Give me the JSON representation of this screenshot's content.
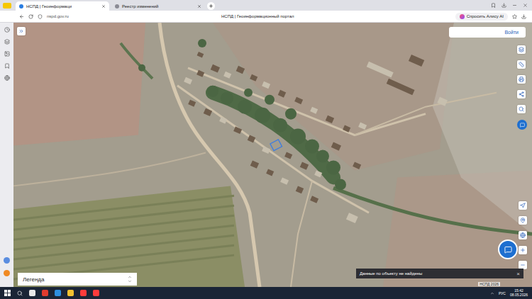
{
  "browser": {
    "tabs": [
      {
        "label": "НСПД | Геоинформаци",
        "selected": true
      },
      {
        "label": "Реестр изменений",
        "selected": false
      }
    ],
    "address": "nspd.gov.ru",
    "page_title": "НСПД | Геоинформационный портал",
    "alice_button": "Спросить Алису AI"
  },
  "map": {
    "login_button": "Войти",
    "legend": {
      "label": "Легенда",
      "expanded": false
    },
    "toast": {
      "message": "Данные по объекту не найдены",
      "close": "×"
    },
    "attribution": "НСПД 2026"
  },
  "taskbar": {
    "language": "РУС",
    "time": "15:42",
    "date": "08.05.2026"
  }
}
